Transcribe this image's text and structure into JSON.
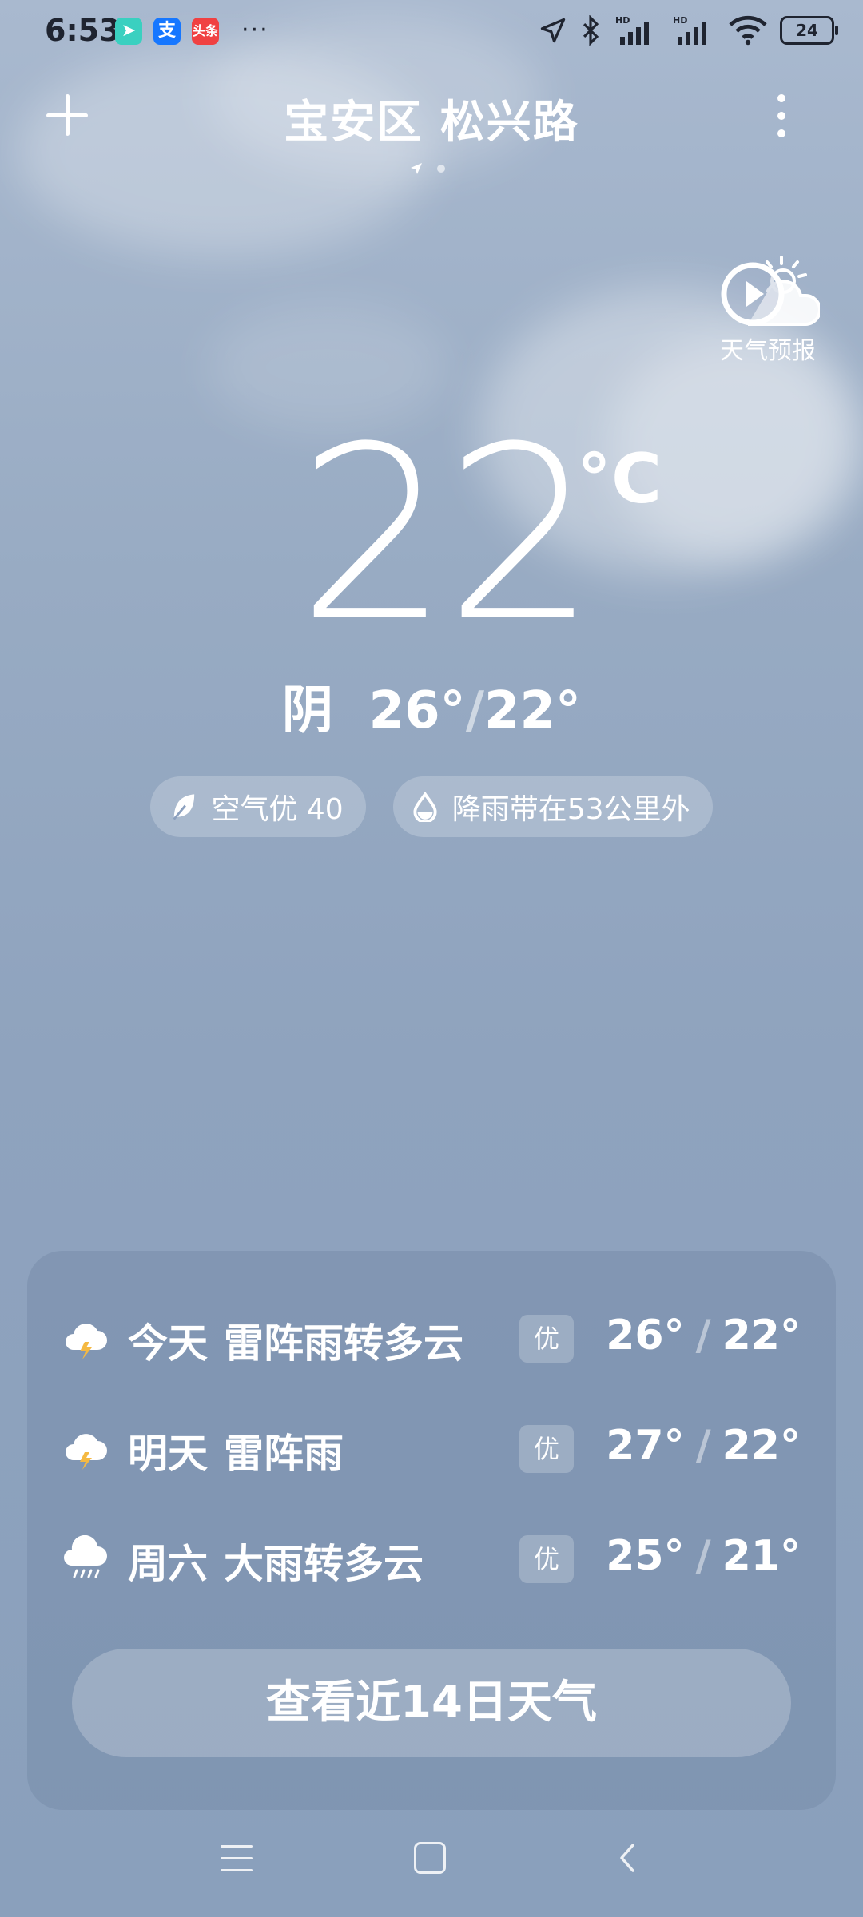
{
  "status_bar": {
    "time": "6:53",
    "apps": [
      "navigation-app-icon",
      "alipay-app-icon",
      "toutiao-app-icon"
    ],
    "toutiao_label": "头条",
    "alipay_label": "支",
    "more": "···",
    "battery": "24",
    "hd1": "HD",
    "hd2": "HD"
  },
  "header": {
    "location": "宝安区 松兴路",
    "forecast_video_label": "天气预报"
  },
  "current": {
    "temperature": "22",
    "unit": "°C",
    "condition": "阴",
    "high": "26°",
    "low": "22°",
    "air_quality": "空气优 40",
    "rain_band": "降雨带在53公里外"
  },
  "forecast": {
    "days": [
      {
        "day": "今天",
        "desc": "雷阵雨转多云",
        "aqi": "优",
        "high": "26°",
        "low": "22°",
        "icon": "thunder-cloud-icon"
      },
      {
        "day": "明天",
        "desc": "雷阵雨",
        "aqi": "优",
        "high": "27°",
        "low": "22°",
        "icon": "thunder-cloud-icon"
      },
      {
        "day": "周六",
        "desc": "大雨转多云",
        "aqi": "优",
        "high": "25°",
        "low": "21°",
        "icon": "rain-cloud-icon"
      }
    ],
    "button": "查看近14日天气"
  },
  "colors": {
    "sky_top": "#a9b9cf",
    "sky_bottom": "#8aa0bc",
    "lightning": "#f5b942"
  }
}
